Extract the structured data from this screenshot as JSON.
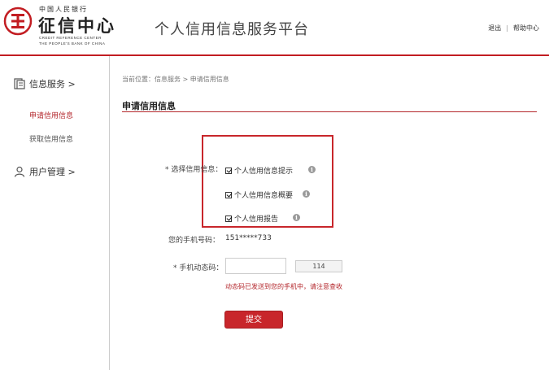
{
  "header": {
    "logo_top": "中国人民银行",
    "logo_main": "征信中心",
    "logo_en_line1": "CREDIT REFERENCE CENTER",
    "logo_en_line2": "THE PEOPLE'S BANK OF CHINA",
    "platform_title": "个人信用信息服务平台",
    "logout_label": "退出",
    "separator": "|",
    "help_label": "帮助中心"
  },
  "sidebar": {
    "group_info": "信息服务 >",
    "item_apply": "申请信用信息",
    "item_get": "获取信用信息",
    "group_user": "用户管理 >"
  },
  "main": {
    "breadcrumb": "当前位置：信息服务 > 申请信用信息",
    "section_title": "申请信用信息",
    "select_label": "* 选择信用信息：",
    "options": [
      {
        "label": "个人信用信息提示",
        "checked": true
      },
      {
        "label": "个人信用信息概要",
        "checked": true
      },
      {
        "label": "个人信用报告",
        "checked": true
      }
    ],
    "info_icon_glyph": "i",
    "phone_label": "您的手机号码：",
    "phone_value": "151*****733",
    "code_label": "* 手机动态码：",
    "code_value": "",
    "code_button": "114",
    "hint": "动态码已发送到您的手机中，请注意查收",
    "submit": "提交"
  },
  "colors": {
    "accent": "#c8262b",
    "text_red": "#b3262b"
  },
  "icons": {
    "logo": "seal-logo-icon",
    "info_service": "document-icon",
    "user_management": "user-icon",
    "option_info": "info-icon"
  }
}
